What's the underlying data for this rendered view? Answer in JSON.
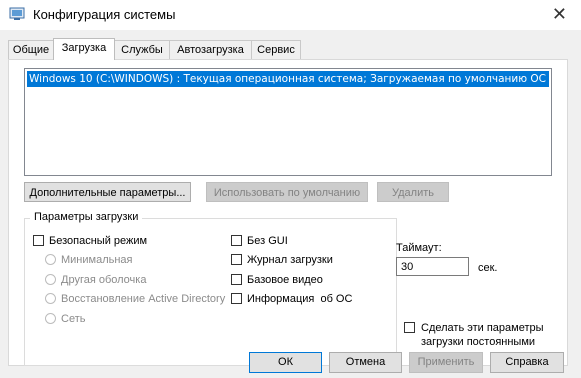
{
  "window": {
    "title": "Конфигурация системы",
    "close_glyph": "✕"
  },
  "tabs": [
    {
      "label": "Общие"
    },
    {
      "label": "Загрузка"
    },
    {
      "label": "Службы"
    },
    {
      "label": "Автозагрузка"
    },
    {
      "label": "Сервис"
    }
  ],
  "active_tab": "Загрузка",
  "boot_list": {
    "items": [
      "Windows 10 (C:\\WINDOWS) : Текущая операционная система; Загружаемая по умолчанию ОС"
    ],
    "selected_index": 0
  },
  "buttons": {
    "advanced": "Дополнительные параметры...",
    "set_default": "Использовать по умолчанию",
    "delete": "Удалить"
  },
  "boot_options": {
    "label": "Параметры загрузки",
    "safe_boot": {
      "label": "Безопасный режим",
      "checked": false
    },
    "minimal": "Минимальная",
    "alternate_shell": "Другая оболочка",
    "ad_repair": "Восстановление Active Directory",
    "network": "Сеть",
    "no_gui": {
      "label": "Без GUI",
      "checked": false
    },
    "boot_log": {
      "label": "Журнал загрузки",
      "checked": false
    },
    "base_video": {
      "label": "Базовое видео",
      "checked": false
    },
    "os_info": {
      "label": "Информация  об ОС",
      "checked": false
    }
  },
  "timeout": {
    "label": "Таймаут:",
    "value": "30",
    "unit": "сек."
  },
  "make_permanent": {
    "line1": "Сделать эти параметры",
    "line2": "загрузки постоянными",
    "checked": false
  },
  "footer": {
    "ok": "ОК",
    "cancel": "Отмена",
    "apply": "Применить",
    "help": "Справка"
  },
  "colors": {
    "selection": "#0078d7",
    "dialog_bg": "#f0f0f0",
    "panel_bg": "#ffffff"
  },
  "icons": {
    "app": "msconfig-icon",
    "close": "close-icon"
  }
}
